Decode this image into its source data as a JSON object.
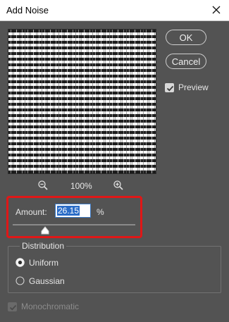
{
  "window": {
    "title": "Add Noise"
  },
  "buttons": {
    "ok": "OK",
    "cancel": "Cancel"
  },
  "preview": {
    "label": "Preview",
    "checked": true
  },
  "zoom": {
    "level": "100%",
    "zoom_out_icon": "zoom-out-icon",
    "zoom_in_icon": "zoom-in-icon"
  },
  "amount": {
    "label": "Amount:",
    "value": "26.15",
    "unit": "%",
    "slider_fraction": 0.2615
  },
  "distribution": {
    "title": "Distribution",
    "options": [
      {
        "label": "Uniform",
        "selected": true
      },
      {
        "label": "Gaussian",
        "selected": false
      }
    ]
  },
  "monochromatic": {
    "label": "Monochromatic",
    "checked": true,
    "disabled": true
  },
  "colors": {
    "accent": "#2a6cc7",
    "highlight": "#e01717",
    "background": "#535353"
  }
}
